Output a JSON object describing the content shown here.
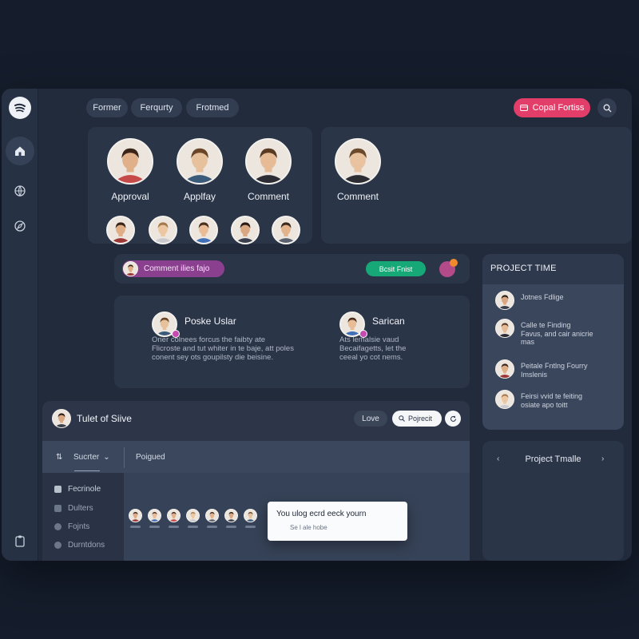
{
  "header": {
    "filters": [
      "Former",
      "Ferqurty",
      "Frotmed"
    ],
    "primary_button": "Copal Fortiss"
  },
  "people_card": {
    "top": [
      {
        "name": "Approval",
        "skin": "#e0b08a",
        "hair": "#3a2518",
        "shirt": "#c74a4a"
      },
      {
        "name": "Applfay",
        "skin": "#e7c09c",
        "hair": "#6a4528",
        "shirt": "#3b5b7a"
      },
      {
        "name": "Comment",
        "skin": "#e6bb96",
        "hair": "#5a3a22",
        "shirt": "#2c2c34"
      }
    ],
    "row": [
      {
        "skin": "#dfae86",
        "hair": "#3a2418",
        "shirt": "#9c3838"
      },
      {
        "skin": "#edc6a2",
        "hair": "#a77a4e",
        "shirt": "#c9c9cf"
      },
      {
        "skin": "#e7bc96",
        "hair": "#4b2e1c",
        "shirt": "#3f70b8"
      },
      {
        "skin": "#d9a882",
        "hair": "#2a1c14",
        "shirt": "#3a3f4c"
      },
      {
        "skin": "#e3b48c",
        "hair": "#3d2a1c",
        "shirt": "#5a6270"
      }
    ]
  },
  "single_card": {
    "name": "Comment",
    "skin": "#e9c2a0",
    "hair": "#6b4a2c",
    "shirt": "#2c2d33"
  },
  "comment_bar": {
    "tag": "Comment ilies fajo",
    "green_button": "Bcsit Fnist"
  },
  "thread": {
    "left_name": "Poske Uslar",
    "left_text": [
      "Oner colnees forcus the faibty ate",
      "Flicroste and tut whiter in te baje, att poles",
      "conent sey ots goupilsty die beisine."
    ],
    "right_name": "Sarican",
    "right_text": [
      "Ats lemalsie vaud",
      "Becaifagetts, let the",
      "ceeal yo cot nems."
    ]
  },
  "project_time": {
    "title": "PROJECT TIME",
    "items": [
      [
        "Jotnes Fdlige"
      ],
      [
        "Calle te Finding",
        "Favus, and cair anicrie",
        "mas"
      ],
      [
        "Peitale Fntlng Fourry",
        "Imslenis"
      ],
      [
        "Feirsi vvid te feiting",
        "osiate apo toitt"
      ]
    ]
  },
  "bottom": {
    "title": "Tulet of Siive",
    "love_button": "Love",
    "search_value": "Pojrecit",
    "tabs": [
      "Sucrter",
      "Poigued"
    ],
    "sidebar": [
      "Fecrinole",
      "Dulters",
      "Fojnts",
      "Durntdons"
    ],
    "tooltip_title": "You ulog ecrd eeck yourn",
    "tooltip_sub": "Se l ale hobe"
  },
  "timeline": {
    "title": "Project Tmalle"
  },
  "colors": {
    "accent_pink": "#e33e69",
    "accent_green": "#17a878",
    "tag_purple": "#8b3f8f"
  }
}
